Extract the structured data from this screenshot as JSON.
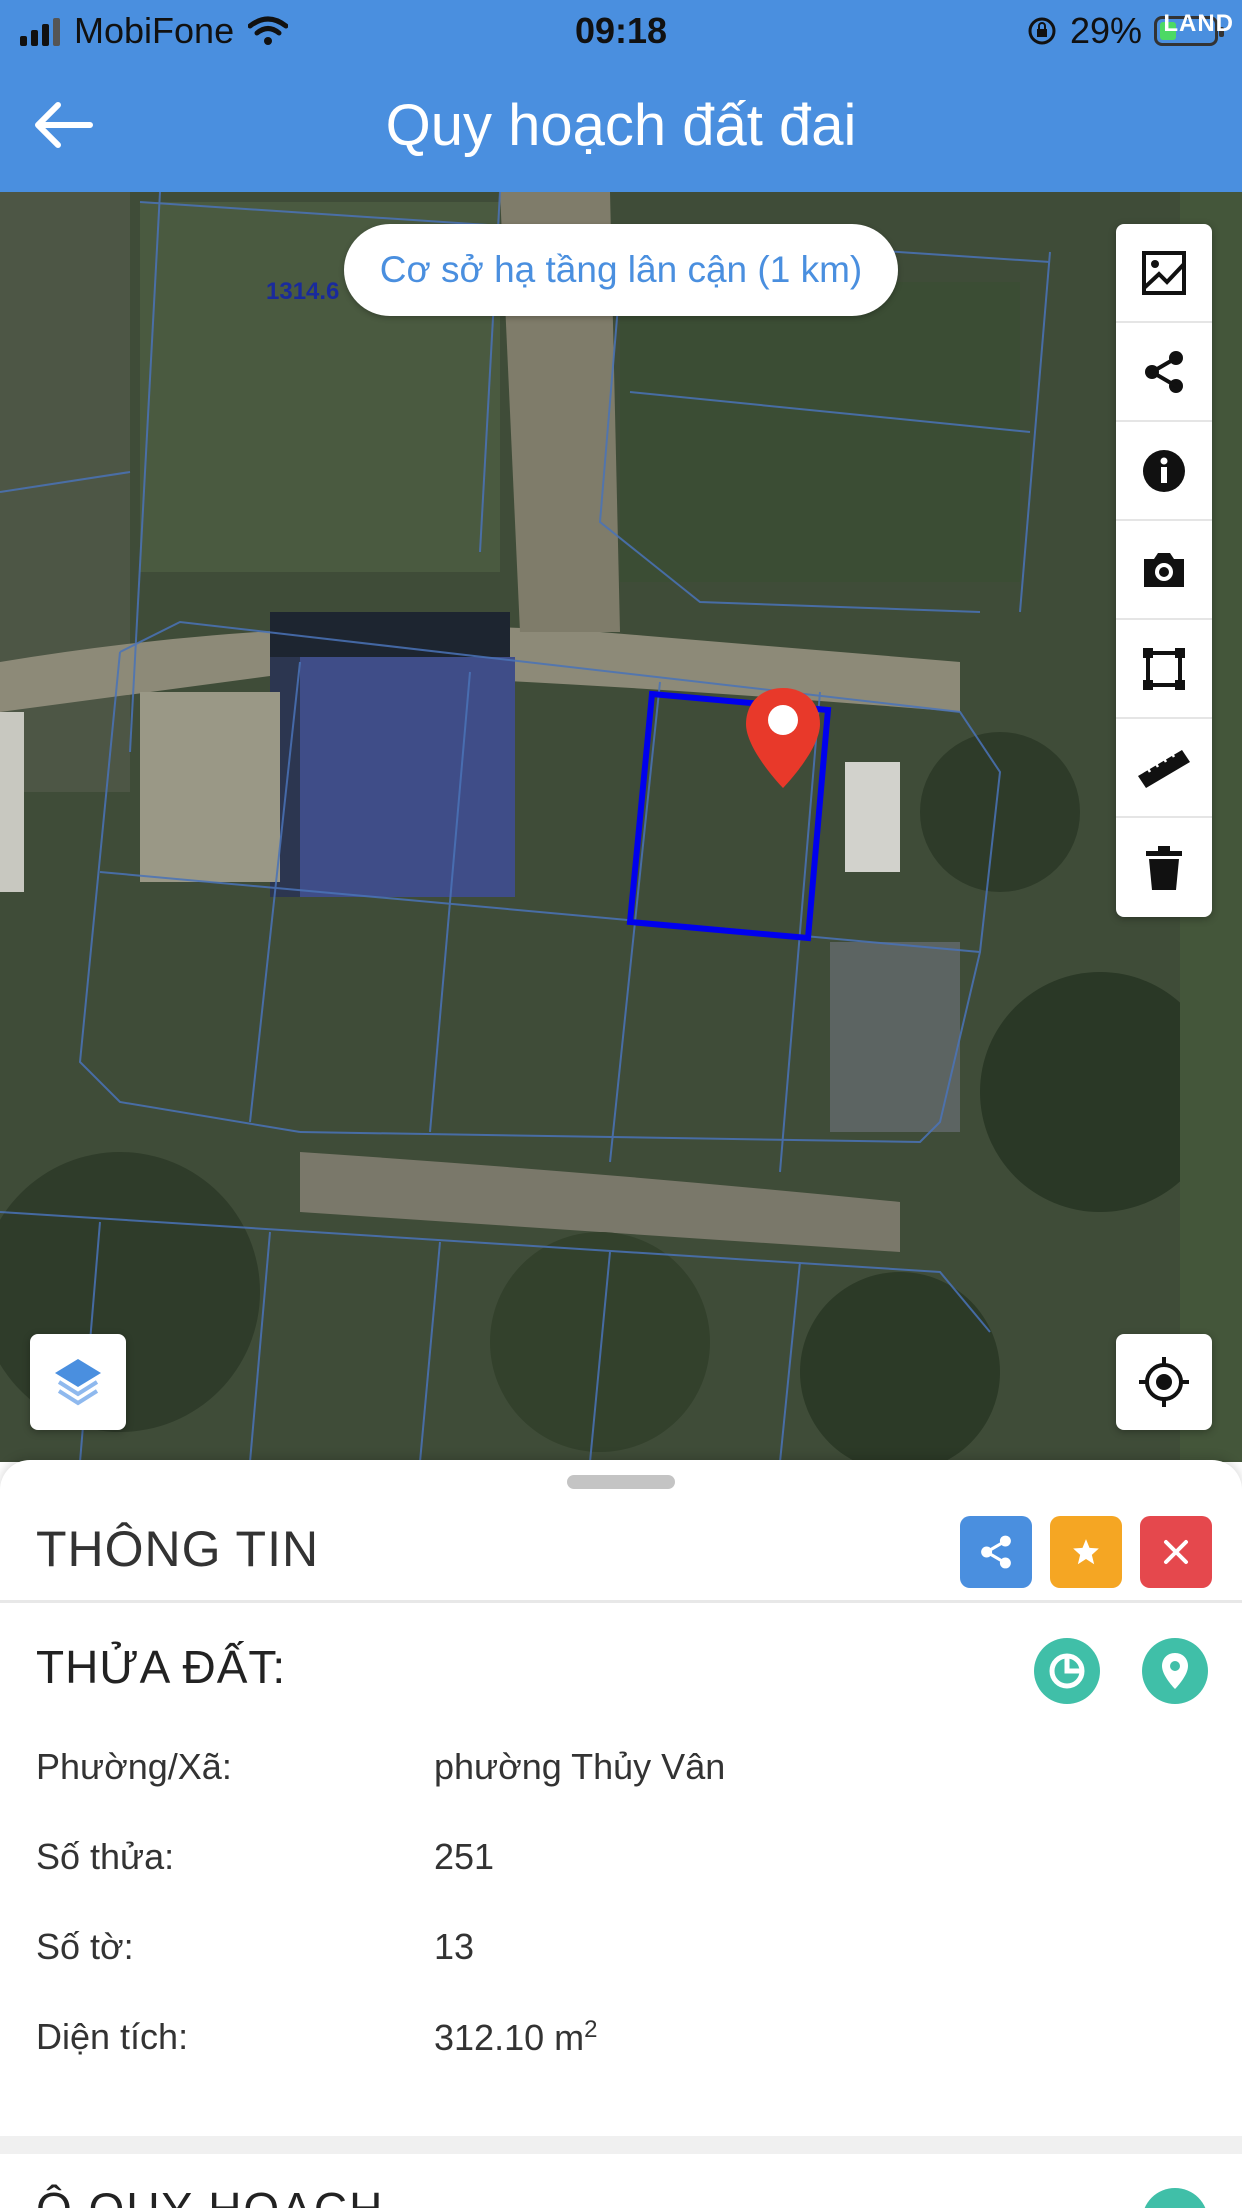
{
  "status_bar": {
    "carrier": "MobiFone",
    "time": "09:18",
    "battery": "29%",
    "brand": "LAND",
    "icons": [
      "signal-icon",
      "wifi-icon",
      "orientation-lock-icon",
      "battery-icon"
    ]
  },
  "header": {
    "title": "Quy hoạch đất đai",
    "back_icon": "arrow-left-icon"
  },
  "map": {
    "parcel_number_label": "1314.6",
    "infra_button": "Cơ sở hạ tầng lân cận (1 km)",
    "tools": [
      "image-icon",
      "share-icon",
      "info-icon",
      "camera-icon",
      "polygon-icon",
      "ruler-icon",
      "trash-icon"
    ],
    "layers_icon": "layers-icon",
    "locate_icon": "crosshair-icon",
    "marker_icon": "map-marker-icon",
    "colors": {
      "parcel_outline": "#0000ee",
      "marker": "#e8392a"
    }
  },
  "sheet": {
    "title": "THÔNG TIN",
    "actions": [
      "share-icon",
      "star-icon",
      "close-icon"
    ],
    "section_title": "THỬA ĐẤT:",
    "section_icons": [
      "pie-chart-icon",
      "location-pin-icon"
    ],
    "rows": [
      {
        "label": "Phường/Xã:",
        "value": "phường Thủy Vân"
      },
      {
        "label": "Số thửa:",
        "value": "251"
      },
      {
        "label": "Số tờ:",
        "value": "13"
      },
      {
        "label": "Diện tích:",
        "value": "312.10 m",
        "sup": "2"
      }
    ],
    "next_section_peek": "Ô QUY HOẠCH",
    "colors": {
      "accent": "#4a8fdf",
      "teal": "#40bfa8",
      "star": "#f5a623",
      "close": "#e5484d"
    }
  }
}
